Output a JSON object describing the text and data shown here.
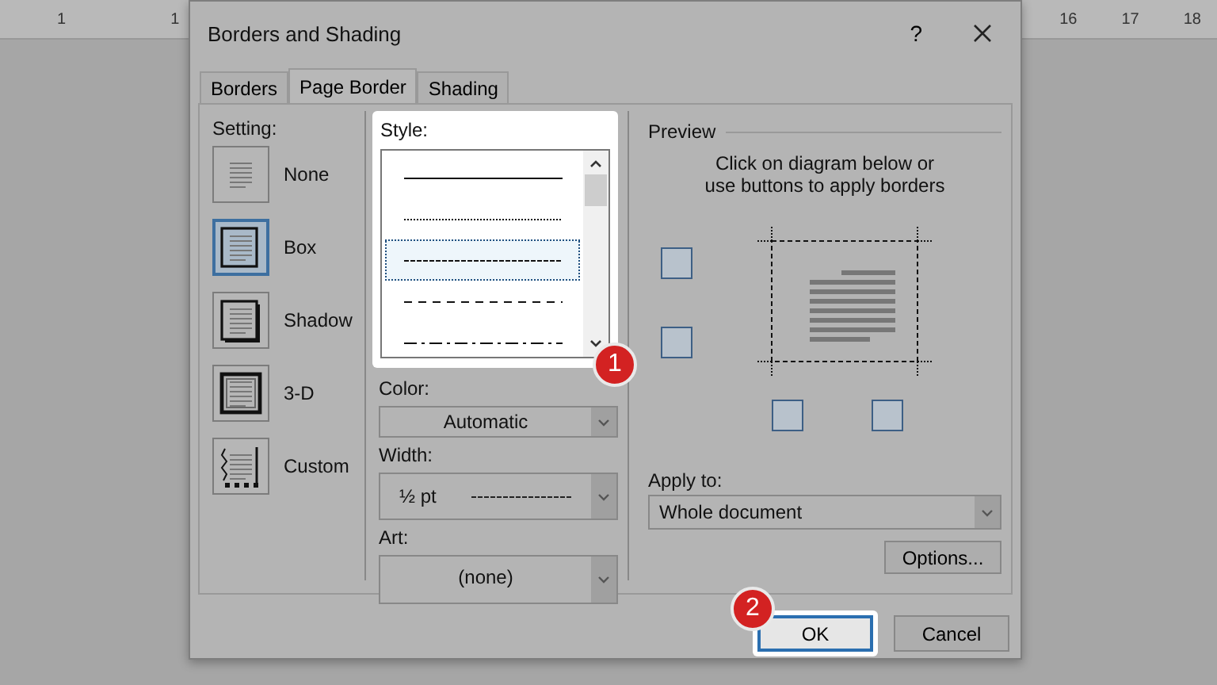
{
  "ruler": {
    "left_labels": [
      "1",
      "1"
    ],
    "right_labels": [
      "16",
      "17",
      "18"
    ]
  },
  "dialog": {
    "title": "Borders and Shading",
    "help": "?"
  },
  "tabs": [
    {
      "label": "Borders",
      "selected": false
    },
    {
      "label": "Page Border",
      "selected": true
    },
    {
      "label": "Shading",
      "selected": false
    }
  ],
  "setting": {
    "label": "Setting:",
    "options": [
      {
        "label": "None",
        "kind": "none",
        "selected": false
      },
      {
        "label": "Box",
        "kind": "box",
        "selected": true
      },
      {
        "label": "Shadow",
        "kind": "shadow",
        "selected": false
      },
      {
        "label": "3-D",
        "kind": "framed",
        "selected": false
      },
      {
        "label": "Custom",
        "kind": "custom",
        "selected": false
      }
    ]
  },
  "style": {
    "label": "Style:",
    "highlighted": true,
    "lines": [
      {
        "kind": "solid",
        "selected": false
      },
      {
        "kind": "dotted",
        "selected": false
      },
      {
        "kind": "fine-dashed",
        "selected": true
      },
      {
        "kind": "dashed",
        "selected": false
      },
      {
        "kind": "dash-dot",
        "selected": false
      }
    ]
  },
  "color": {
    "label": "Color:",
    "value": "Automatic"
  },
  "width": {
    "label": "Width:",
    "value": "½ pt"
  },
  "art": {
    "label": "Art:",
    "value": "(none)"
  },
  "preview": {
    "label": "Preview",
    "hint": "Click on diagram below or use buttons to apply borders"
  },
  "apply_to": {
    "label": "Apply to:",
    "value": "Whole document"
  },
  "options_button": "Options...",
  "buttons": [
    {
      "label": "OK",
      "highlighted": true
    },
    {
      "label": "Cancel",
      "highlighted": false
    }
  ],
  "callouts": [
    "1",
    "2"
  ]
}
